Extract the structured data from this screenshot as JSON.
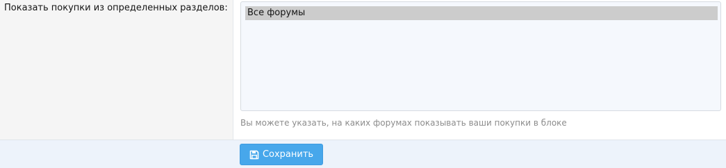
{
  "form": {
    "row_label": "Показать покупки из определенных разделов:",
    "forums_list": {
      "options": [
        "Все форумы"
      ],
      "selected": "Все форумы"
    },
    "hint": "Вы можете указать, на каких форумах показывать ваши покупки в блоке"
  },
  "footer": {
    "save_label": "Сохранить",
    "save_icon": "floppy-disk-icon"
  },
  "colors": {
    "label_bg": "#f5f5f5",
    "listbox_bg": "#f5f8fd",
    "selected_option_bg": "#cccccc",
    "footer_bg": "#edf3fb",
    "button_bg": "#47a7eb",
    "hint_text": "#8c8c8c"
  }
}
